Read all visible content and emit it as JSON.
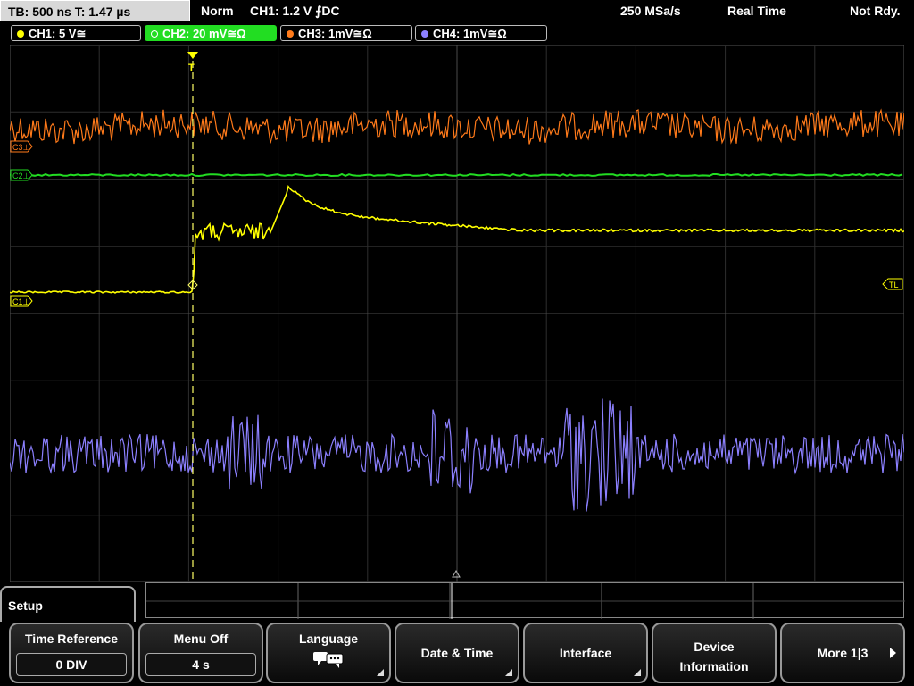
{
  "status": {
    "timebase": "TB: 500 ns   T: 1.47 µs",
    "mode": "Norm",
    "trigger": "CH1: 1.2 V ⨍DC",
    "samplerate": "250 MSa/s",
    "acq": "Real Time",
    "state": "Not Rdy."
  },
  "channels": [
    {
      "label": "CH1: 5 V≅",
      "color": "#ffff00"
    },
    {
      "label": "CH2: 20 mV≅Ω",
      "color": "#22dd22"
    },
    {
      "label": "CH3: 1mV≅Ω",
      "color": "#ff7a1a"
    },
    {
      "label": "CH4: 1mV≅Ω",
      "color": "#8c80ff"
    }
  ],
  "markers": {
    "c3": "C3⊥",
    "c2": "C2⊥",
    "c1": "C1⊥",
    "tl": "TL",
    "trigger_t": "T"
  },
  "menu": {
    "title": "Setup",
    "softkeys": {
      "time_reference": {
        "label": "Time Reference",
        "value": "0 DIV"
      },
      "menu_off": {
        "label": "Menu Off",
        "value": "4 s"
      },
      "language": {
        "label": "Language",
        "icon": "speech-bubbles-icon"
      },
      "date_time": {
        "label": "Date & Time"
      },
      "interface": {
        "label": "Interface"
      },
      "device_info": {
        "line1": "Device",
        "line2": "Information"
      },
      "more": {
        "label": "More 1|3"
      }
    }
  }
}
